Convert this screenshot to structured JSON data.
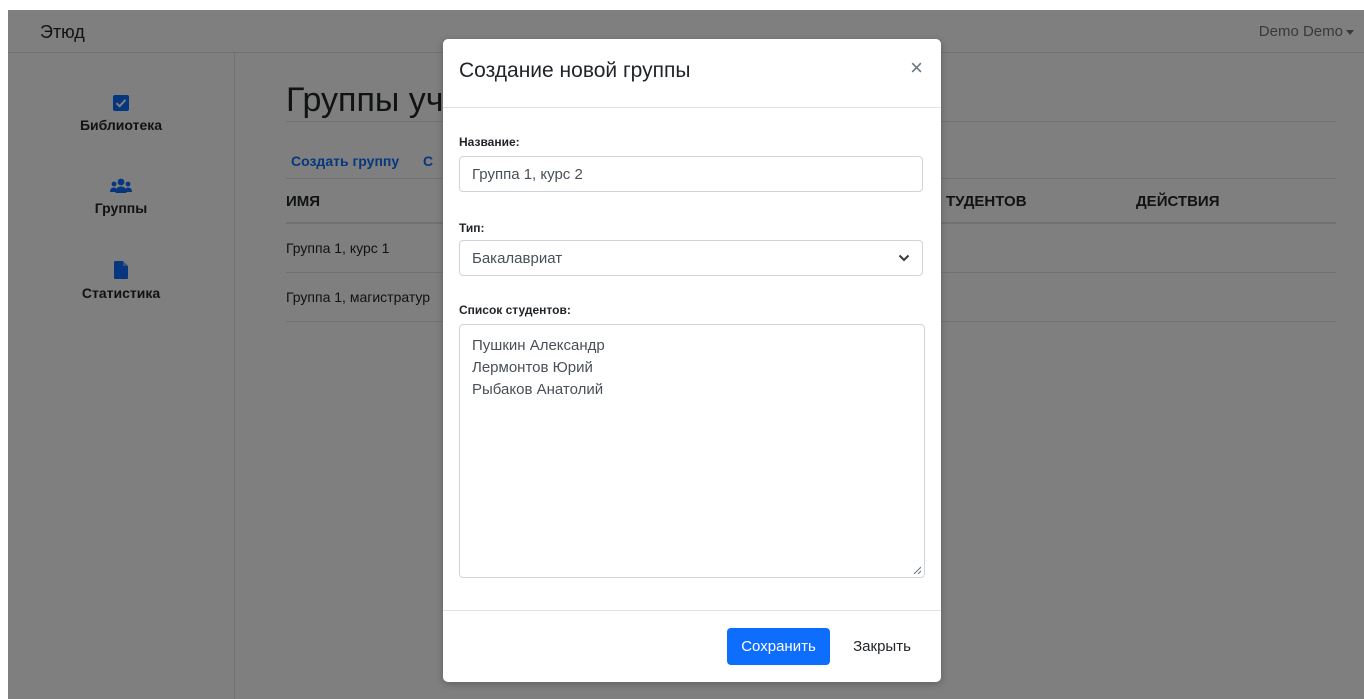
{
  "app": {
    "brand": "Этюд",
    "user": "Demo Demo"
  },
  "sidebar": {
    "items": [
      {
        "label": "Библиотека",
        "icon": "check-square-icon"
      },
      {
        "label": "Группы",
        "icon": "users-icon"
      },
      {
        "label": "Статистика",
        "icon": "file-icon"
      }
    ]
  },
  "main": {
    "title": "Группы уча",
    "actions": [
      "Создать группу",
      "С"
    ],
    "table": {
      "headers": [
        "ИМЯ",
        "ТУДЕНТОВ",
        "ДЕЙСТВИЯ"
      ],
      "rows": [
        [
          "Группа 1, курс 1"
        ],
        [
          "Группа 1, магистратур"
        ]
      ]
    }
  },
  "modal": {
    "title": "Создание новой группы",
    "close_symbol": "×",
    "name_label": "Название:",
    "name_value": "Группа 1, курс 2",
    "type_label": "Тип:",
    "type_value": "Бакалавриат",
    "students_label": "Список студентов:",
    "students": [
      "Пушкин Александр",
      "Лермонтов Юрий",
      "Рыбаков Анатолий"
    ],
    "save_label": "Сохранить",
    "close_label": "Закрыть"
  },
  "colors": {
    "accent": "#0d6efd",
    "backdrop": "rgba(0,0,0,0.5)"
  }
}
